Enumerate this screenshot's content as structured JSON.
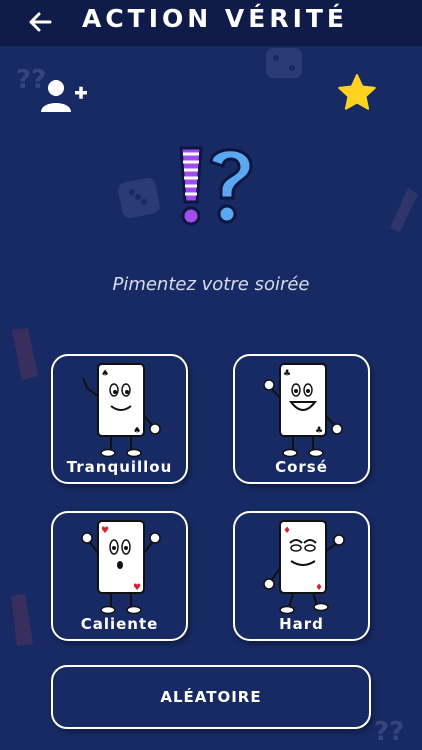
{
  "header": {
    "title": "ACTION VÉRITÉ",
    "back_icon": "arrow-left-icon"
  },
  "toolbar": {
    "add_player_icon": "person-add-icon",
    "favorite_icon": "star-icon",
    "star_color": "#ffd21f"
  },
  "tagline": "Pimentez votre soirée",
  "modes": [
    {
      "label": "Tranquillou"
    },
    {
      "label": "Corsé"
    },
    {
      "label": "Caliente"
    },
    {
      "label": "Hard"
    }
  ],
  "random_button": {
    "label": "ALÉATOIRE"
  },
  "colors": {
    "background": "#172a63",
    "header": "#0f1c49",
    "accent_purple": "#a24cf0",
    "accent_blue": "#5aa9f0"
  }
}
